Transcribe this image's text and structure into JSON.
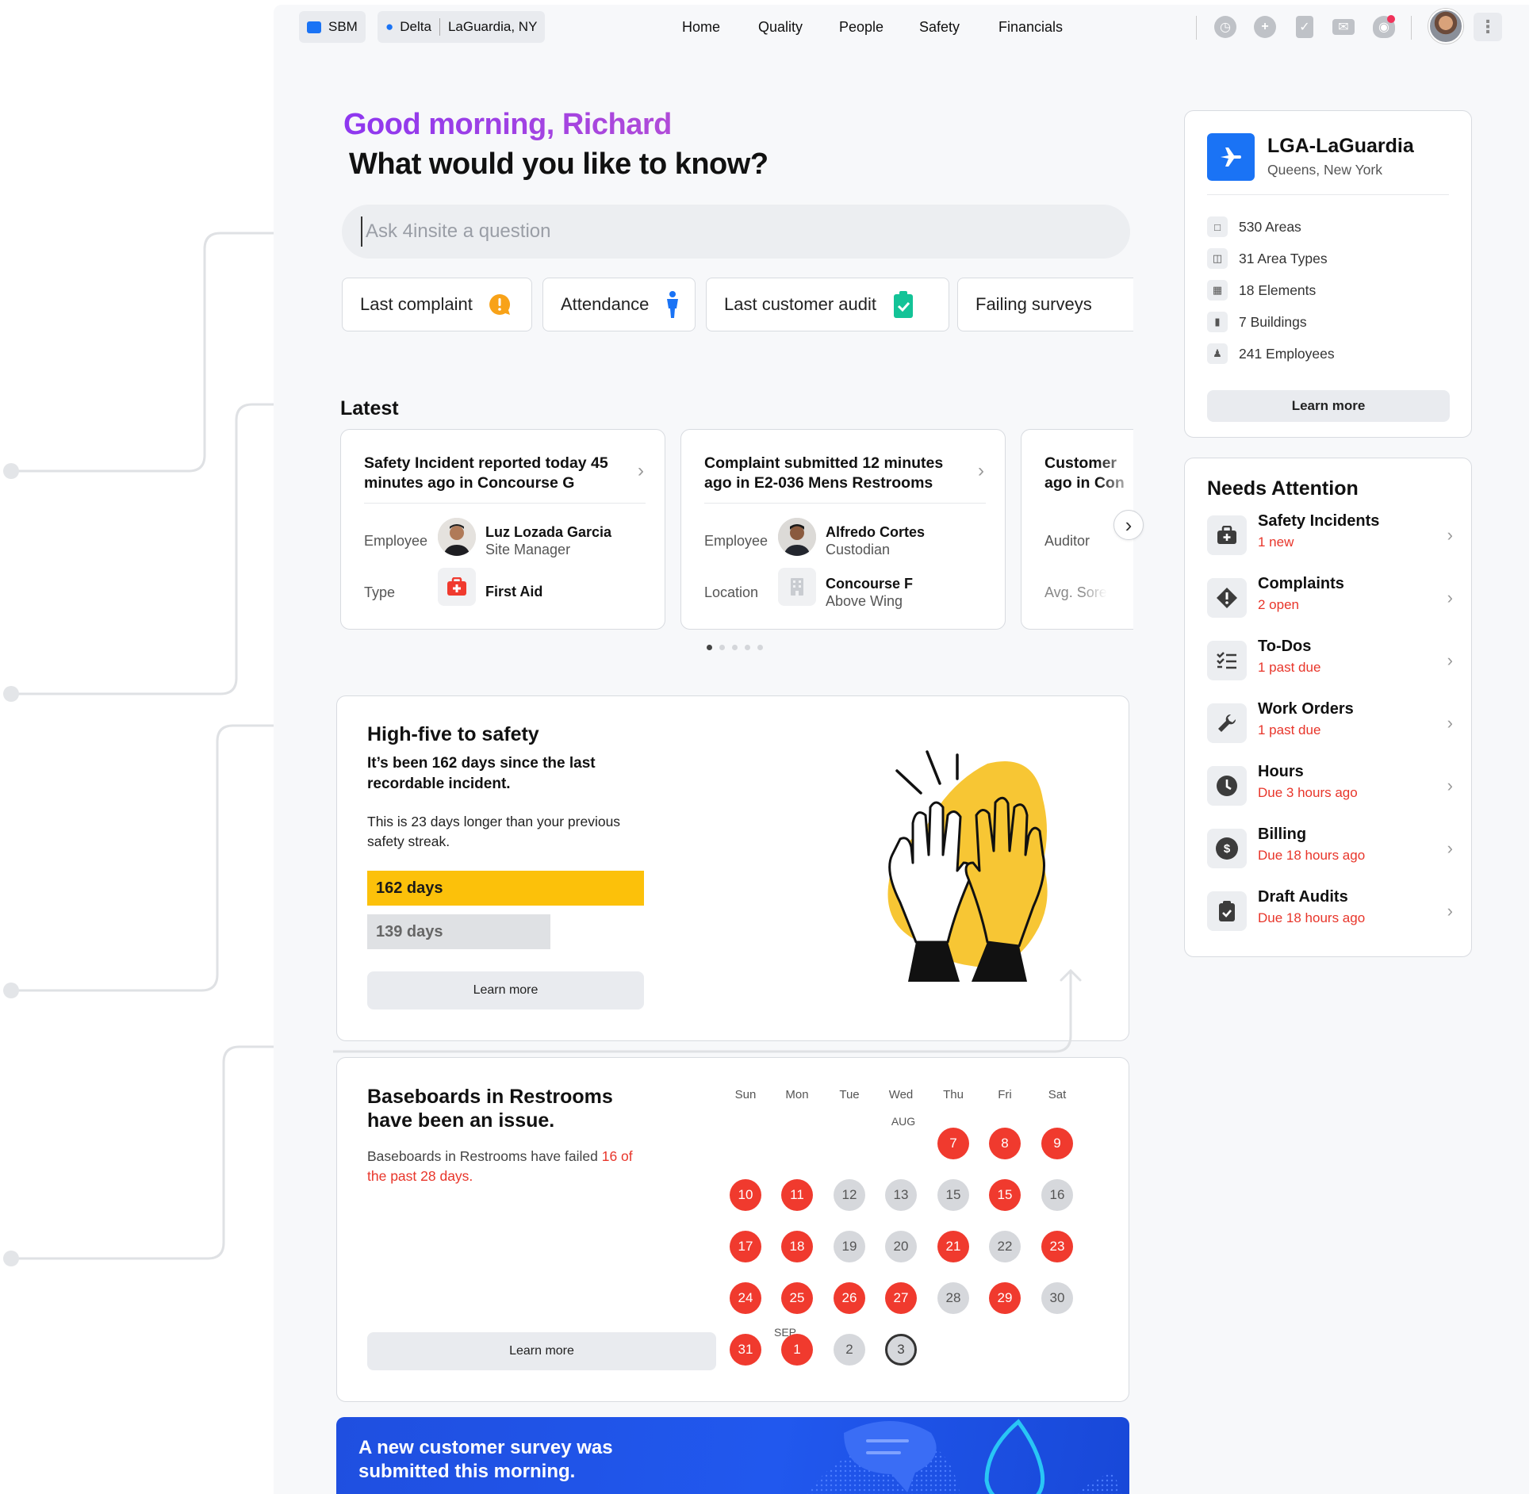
{
  "topbar": {
    "company": "SBM",
    "client": "Delta",
    "site": "LaGuardia, NY",
    "nav": [
      "Home",
      "Quality",
      "People",
      "Safety",
      "Financials"
    ],
    "icons": [
      "clock-icon",
      "plus-icon",
      "clipboard-icon",
      "mail-icon",
      "bell-icon"
    ]
  },
  "greeting": {
    "line1": "Good morning, Richard",
    "line2": "What would you like to know?"
  },
  "search": {
    "placeholder": "Ask 4insite a question"
  },
  "suggestions": [
    "Last complaint",
    "Attendance",
    "Last customer audit",
    "Failing surveys"
  ],
  "latest": {
    "title": "Latest",
    "cards": [
      {
        "title": "Safety Incident reported today 45 minutes ago in Concourse G",
        "row1_label": "Employee",
        "row1_name": "Luz Lozada Garcia",
        "row1_sub": "Site Manager",
        "row2_label": "Type",
        "row2_name": "First Aid"
      },
      {
        "title": "Complaint submitted 12 minutes ago in E2-036 Mens Restrooms",
        "row1_label": "Employee",
        "row1_name": "Alfredo Cortes",
        "row1_sub": "Custodian",
        "row2_label": "Location",
        "row2_name": "Concourse F",
        "row2_sub": "Above Wing"
      },
      {
        "title_l1": "Customer",
        "title_l2": "ago in Con",
        "row1_label": "Auditor",
        "row2_label": "Avg. Sore"
      }
    ]
  },
  "safety": {
    "title": "High-five to safety",
    "headline": "It’s been 162 days since the last recordable incident.",
    "body": "This is 23 days longer than your previous safety streak.",
    "current_label": "162 days",
    "current_days": 162,
    "previous_label": "139 days",
    "previous_days": 139,
    "accent": "#fcc10a",
    "button": "Learn more"
  },
  "baseboards": {
    "title": "Baseboards in Restrooms have been an issue.",
    "body_prefix": "Baseboards in Restrooms have failed ",
    "body_highlight": "16 of the past 28 days.",
    "button": "Learn more",
    "weekdays": [
      "Sun",
      "Mon",
      "Tue",
      "Wed",
      "Thu",
      "Fri",
      "Sat"
    ],
    "month_aug": "AUG",
    "month_sep": "SEP",
    "days": [
      {
        "n": "7",
        "s": "fail"
      },
      {
        "n": "8",
        "s": "fail"
      },
      {
        "n": "9",
        "s": "fail"
      },
      {
        "n": "10",
        "s": "fail"
      },
      {
        "n": "11",
        "s": "fail"
      },
      {
        "n": "12",
        "s": "ok"
      },
      {
        "n": "13",
        "s": "ok"
      },
      {
        "n": "15",
        "s": "ok"
      },
      {
        "n": "15",
        "s": "fail"
      },
      {
        "n": "16",
        "s": "ok"
      },
      {
        "n": "17",
        "s": "fail"
      },
      {
        "n": "18",
        "s": "fail"
      },
      {
        "n": "19",
        "s": "ok"
      },
      {
        "n": "20",
        "s": "ok"
      },
      {
        "n": "21",
        "s": "fail"
      },
      {
        "n": "22",
        "s": "ok"
      },
      {
        "n": "23",
        "s": "fail"
      },
      {
        "n": "24",
        "s": "fail"
      },
      {
        "n": "25",
        "s": "fail"
      },
      {
        "n": "26",
        "s": "fail"
      },
      {
        "n": "27",
        "s": "fail"
      },
      {
        "n": "28",
        "s": "ok"
      },
      {
        "n": "29",
        "s": "fail"
      },
      {
        "n": "30",
        "s": "ok"
      },
      {
        "n": "31",
        "s": "fail"
      },
      {
        "n": "1",
        "s": "fail"
      },
      {
        "n": "2",
        "s": "ok"
      },
      {
        "n": "3",
        "s": "today"
      }
    ],
    "fail_color": "#f03a2e"
  },
  "survey": {
    "text": "A new customer survey was submitted this morning."
  },
  "site": {
    "name": "LGA-LaGuardia",
    "location": "Queens, New York",
    "stats": [
      "530 Areas",
      "31 Area Types",
      "18 Elements",
      "7 Buildings",
      "241 Employees"
    ],
    "button": "Learn more",
    "accent": "#1a73f5"
  },
  "attention": {
    "title": "Needs Attention",
    "items": [
      {
        "title": "Safety Incidents",
        "sub": "1 new",
        "icon": "medkit-icon"
      },
      {
        "title": "Complaints",
        "sub": "2 open",
        "icon": "warning-icon"
      },
      {
        "title": "To-Dos",
        "sub": "1 past due",
        "icon": "checklist-icon"
      },
      {
        "title": "Work Orders",
        "sub": "1 past due",
        "icon": "wrench-icon"
      },
      {
        "title": "Hours",
        "sub": "Due 3 hours ago",
        "icon": "clock-icon"
      },
      {
        "title": "Billing",
        "sub": "Due 18 hours ago",
        "icon": "dollar-icon"
      },
      {
        "title": "Draft Audits",
        "sub": "Due 18 hours ago",
        "icon": "clipboard-icon"
      }
    ],
    "alert_color": "#e8352a"
  }
}
